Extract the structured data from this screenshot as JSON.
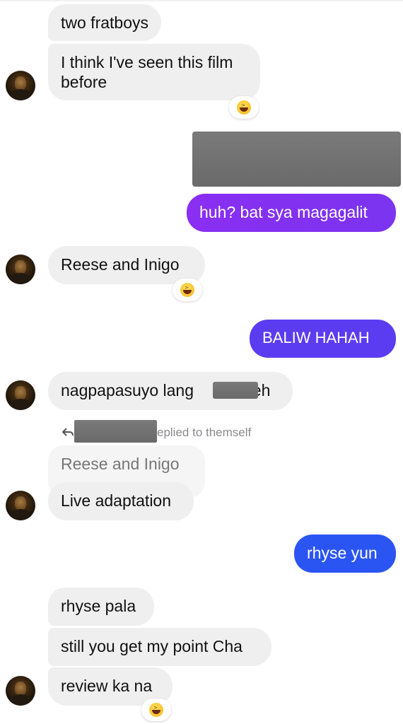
{
  "colors": {
    "incoming_bubble": "#efeff0",
    "outgoing_purple": "#8a2ef2",
    "outgoing_violet": "#5b3cf0",
    "outgoing_blue": "#2b55f3",
    "redaction": "#6e6e6e"
  },
  "messages": {
    "m1": "two fratboys",
    "m2_line1": "I think I've seen this film",
    "m2_line2": "before",
    "m3": "huh? bat sya magagalit",
    "m4": "Reese and  Inigo",
    "m5": "BALIW HAHAH",
    "m6_a": "nagpapasuyo lang",
    "m6_b": "eh",
    "reply_label": "eplied to themself",
    "quoted": "Reese and  Inigo",
    "m7": "Live adaptation",
    "m8": "rhyse yun",
    "m9": "rhyse pala",
    "m10": "still you get my point Cha",
    "m11": "review ka na"
  },
  "icons": {
    "reaction": "laughing-squinting-face-emoji",
    "avatar": "contact-profile-photo",
    "reply": "reply-arrow-icon"
  }
}
